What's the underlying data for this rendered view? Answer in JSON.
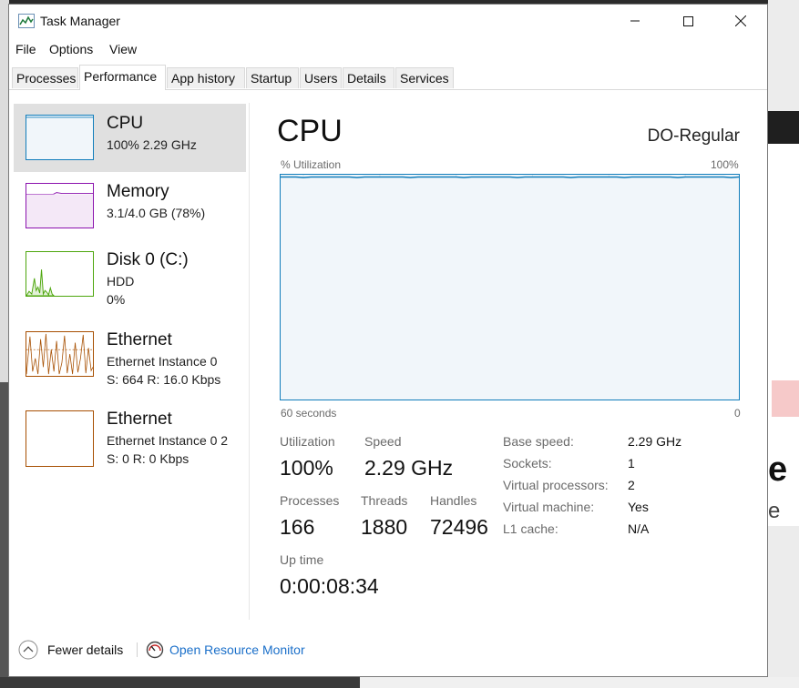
{
  "window": {
    "title": "Task Manager"
  },
  "menu": [
    "File",
    "Options",
    "View"
  ],
  "tabs": [
    {
      "label": "Processes",
      "active": false
    },
    {
      "label": "Performance",
      "active": true
    },
    {
      "label": "App history",
      "active": false
    },
    {
      "label": "Startup",
      "active": false
    },
    {
      "label": "Users",
      "active": false
    },
    {
      "label": "Details",
      "active": false
    },
    {
      "label": "Services",
      "active": false
    }
  ],
  "sidebar": [
    {
      "title": "CPU",
      "sub1": "100%  2.29 GHz",
      "sub2": "",
      "color": "#117dbb",
      "selected": true
    },
    {
      "title": "Memory",
      "sub1": "3.1/4.0 GB (78%)",
      "sub2": "",
      "color": "#8b12ae",
      "selected": false
    },
    {
      "title": "Disk 0 (C:)",
      "sub1": "HDD",
      "sub2": "0%",
      "color": "#4da60c",
      "selected": false
    },
    {
      "title": "Ethernet",
      "sub1": "Ethernet Instance 0",
      "sub2": "S: 664  R: 16.0 Kbps",
      "color": "#a74f01",
      "selected": false
    },
    {
      "title": "Ethernet",
      "sub1": "Ethernet Instance 0 2",
      "sub2": "S: 0  R: 0 Kbps",
      "color": "#a74f01",
      "selected": false
    }
  ],
  "main": {
    "title": "CPU",
    "model": "DO-Regular",
    "graph": {
      "top_left": "% Utilization",
      "top_right": "100%",
      "bottom_left": "60 seconds",
      "bottom_right": "0",
      "utilization_percent": 99
    },
    "stats": {
      "utilization_label": "Utilization",
      "utilization": "100%",
      "speed_label": "Speed",
      "speed": "2.29 GHz",
      "processes_label": "Processes",
      "processes": "166",
      "threads_label": "Threads",
      "threads": "1880",
      "handles_label": "Handles",
      "handles": "72496",
      "uptime_label": "Up time",
      "uptime": "0:00:08:34"
    },
    "specs": [
      {
        "label": "Base speed:",
        "value": "2.29 GHz"
      },
      {
        "label": "Sockets:",
        "value": "1"
      },
      {
        "label": "Virtual processors:",
        "value": "2"
      },
      {
        "label": "Virtual machine:",
        "value": "Yes"
      },
      {
        "label": "L1 cache:",
        "value": "N/A"
      }
    ]
  },
  "footer": {
    "fewer_details": "Fewer details",
    "resource_monitor": "Open Resource Monitor"
  },
  "background": {
    "glyph1": "e",
    "glyph2": "e"
  }
}
